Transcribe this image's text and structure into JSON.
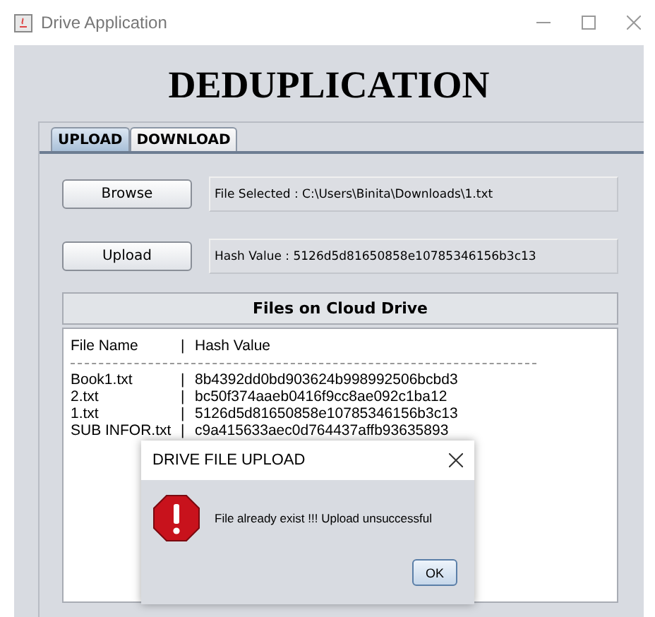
{
  "window": {
    "title": "Drive Application"
  },
  "heading": "DEDUPLICATION",
  "tabs": [
    {
      "label": "UPLOAD",
      "selected": true
    },
    {
      "label": "DOWNLOAD",
      "selected": false
    }
  ],
  "actions": [
    {
      "button": "Browse",
      "field": "File Selected : C:\\Users\\Binita\\Downloads\\1.txt"
    },
    {
      "button": "Upload",
      "field": "Hash Value : 5126d5d81650858e10785346156b3c13"
    }
  ],
  "files_panel": {
    "title": "Files on Cloud Drive",
    "columns": [
      "File Name",
      "|",
      "Hash Value"
    ],
    "rows": [
      [
        "Book1.txt",
        "|",
        "8b4392dd0bd903624b998992506bcbd3"
      ],
      [
        "2.txt",
        "|",
        "bc50f374aaeb0416f9cc8ae092c1ba12"
      ],
      [
        "1.txt",
        "|",
        "5126d5d81650858e10785346156b3c13"
      ],
      [
        "SUB INFOR.txt",
        "|",
        "c9a415633aec0d764437affb93635893"
      ]
    ]
  },
  "dialog": {
    "title": "DRIVE FILE UPLOAD",
    "kind": "error",
    "message": "File already exist !!! Upload unsuccessful",
    "button": "OK"
  }
}
